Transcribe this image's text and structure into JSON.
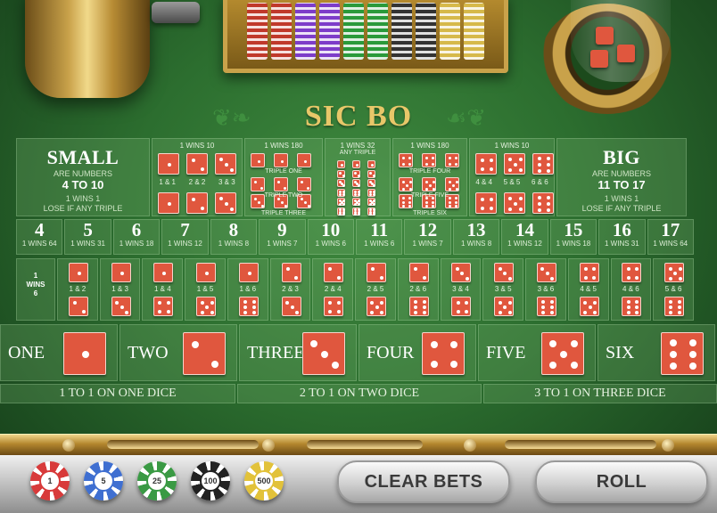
{
  "title": "SIC BO",
  "small": {
    "label": "SMALL",
    "sub": "ARE NUMBERS",
    "range": "4 TO 10",
    "pay": "1 WINS 1",
    "rule": "LOSE IF ANY TRIPLE"
  },
  "big": {
    "label": "BIG",
    "sub": "ARE NUMBERS",
    "range": "11 TO 17",
    "pay": "1 WINS 1",
    "rule": "LOSE IF ANY TRIPLE"
  },
  "doubles_left": {
    "pay": "1 WINS 10",
    "labels": [
      "1 & 1",
      "2 & 2",
      "3 & 3"
    ]
  },
  "doubles_right": {
    "pay": "1 WINS 10",
    "labels": [
      "4 & 4",
      "5 & 5",
      "6 & 6"
    ]
  },
  "triples_left": {
    "pay": "1 WINS 180",
    "labels": [
      "TRIPLE ONE",
      "TRIPLE TWO",
      "TRIPLE THREE"
    ]
  },
  "triples_right": {
    "pay": "1 WINS 180",
    "labels": [
      "TRIPLE FOUR",
      "TRIPLE FIVE",
      "TRIPLE SIX"
    ]
  },
  "any_triple": {
    "pay": "1 WINS 32",
    "label": "ANY TRIPLE"
  },
  "totals": [
    {
      "n": "4",
      "pay": "1 WINS 64"
    },
    {
      "n": "5",
      "pay": "1 WINS 31"
    },
    {
      "n": "6",
      "pay": "1 WINS 18"
    },
    {
      "n": "7",
      "pay": "1 WINS 12"
    },
    {
      "n": "8",
      "pay": "1 WINS 8"
    },
    {
      "n": "9",
      "pay": "1 WINS 7"
    },
    {
      "n": "10",
      "pay": "1 WINS 6"
    },
    {
      "n": "11",
      "pay": "1 WINS 6"
    },
    {
      "n": "12",
      "pay": "1 WINS 7"
    },
    {
      "n": "13",
      "pay": "1 WINS 8"
    },
    {
      "n": "14",
      "pay": "1 WINS 12"
    },
    {
      "n": "15",
      "pay": "1 WINS 18"
    },
    {
      "n": "16",
      "pay": "1 WINS 31"
    },
    {
      "n": "17",
      "pay": "1 WINS 64"
    }
  ],
  "combos_payout": [
    "1",
    "WINS",
    "6"
  ],
  "combos": [
    "1 & 2",
    "1 & 3",
    "1 & 4",
    "1 & 5",
    "1 & 6",
    "2 & 3",
    "2 & 4",
    "2 & 5",
    "2 & 6",
    "3 & 4",
    "3 & 5",
    "3 & 6",
    "4 & 5",
    "4 & 6",
    "5 & 6"
  ],
  "singles": [
    {
      "label": "ONE",
      "face": 1
    },
    {
      "label": "TWO",
      "face": 2
    },
    {
      "label": "THREE",
      "face": 3
    },
    {
      "label": "FOUR",
      "face": 4
    },
    {
      "label": "FIVE",
      "face": 5
    },
    {
      "label": "SIX",
      "face": 6
    }
  ],
  "payouts": [
    "1 TO 1 ON ONE DICE",
    "2 TO 1 ON TWO DICE",
    "3 TO 1 ON THREE DICE"
  ],
  "chips": [
    {
      "value": "1",
      "color": "#d83a3a"
    },
    {
      "value": "5",
      "color": "#3f6fd1"
    },
    {
      "value": "25",
      "color": "#3a9a44"
    },
    {
      "value": "100",
      "color": "#222222"
    },
    {
      "value": "500",
      "color": "#e2c23a"
    }
  ],
  "buttons": {
    "clear": "CLEAR BETS",
    "roll": "ROLL"
  },
  "colors": {
    "felt": "#2c6e2f",
    "die": "#e0573e",
    "gold": "#e8c769"
  }
}
